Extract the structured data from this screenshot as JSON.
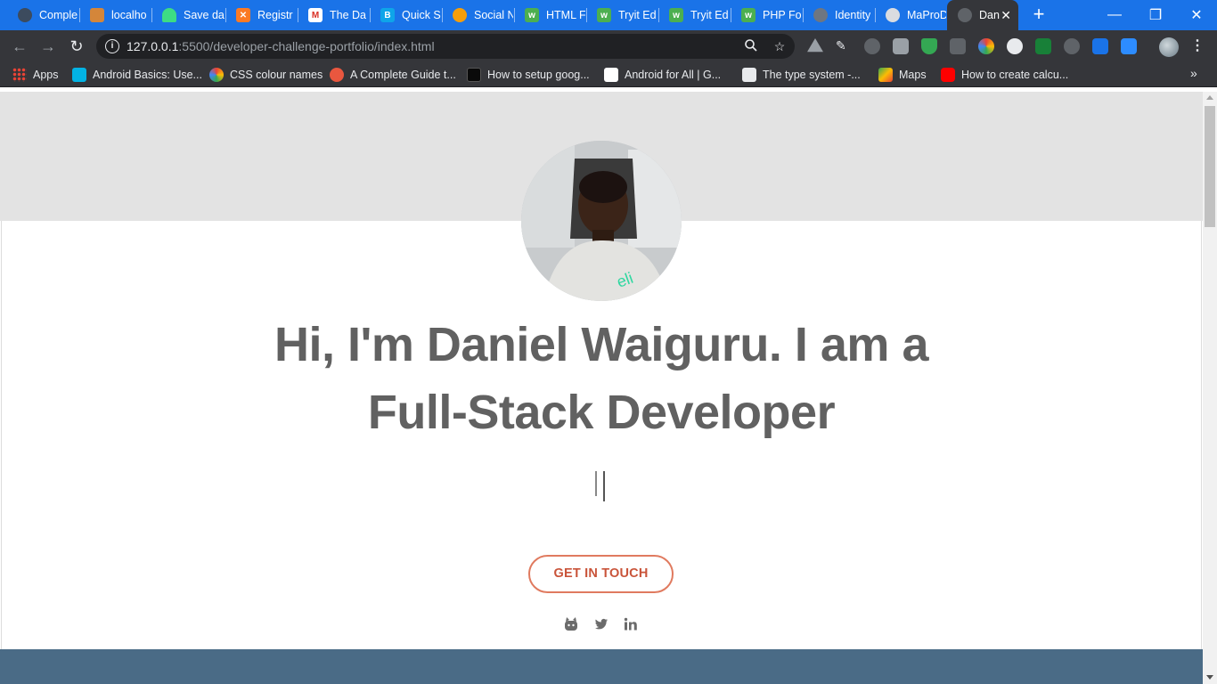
{
  "browser": {
    "tabs": [
      {
        "title": "Comple",
        "icon": "github-icon",
        "color": "#24292e",
        "active": false
      },
      {
        "title": "localho",
        "icon": "server-icon",
        "color": "#f4a460",
        "active": false
      },
      {
        "title": "Save da",
        "icon": "android-icon",
        "color": "#3ddc84",
        "active": false
      },
      {
        "title": "Registr",
        "icon": "xampp-icon",
        "color": "#fb7a24",
        "active": false
      },
      {
        "title": "The Da",
        "icon": "gmail-icon",
        "color": "#d93025",
        "active": false
      },
      {
        "title": "Quick S",
        "icon": "bootstrap-icon",
        "color": "#0ea5e9",
        "active": false
      },
      {
        "title": "Social N",
        "icon": "settings-icon",
        "color": "#f59e0b",
        "active": false
      },
      {
        "title": "HTML F",
        "icon": "w3schools-icon",
        "color": "#4caf50",
        "active": false
      },
      {
        "title": "Tryit Ed",
        "icon": "w3schools-icon",
        "color": "#4caf50",
        "active": false
      },
      {
        "title": "Tryit Ed",
        "icon": "w3schools-icon",
        "color": "#4caf50",
        "active": false
      },
      {
        "title": "PHP For",
        "icon": "w3schools-icon",
        "color": "#4caf50",
        "active": false
      },
      {
        "title": "Identity",
        "icon": "github-icon",
        "color": "#6e7681",
        "active": false
      },
      {
        "title": "MaProD",
        "icon": "globe-icon",
        "color": "#9aa0a6",
        "active": false
      },
      {
        "title": "Dan",
        "icon": "globe-icon",
        "color": "#9aa0a6",
        "active": true
      }
    ],
    "new_tab_label": "+",
    "window_controls": {
      "minimize": "—",
      "restore": "❐",
      "close": "✕"
    },
    "address": {
      "host": "127.0.0.1",
      "path": ":5500/developer-challenge-portfolio/index.html"
    },
    "bookmarks": [
      {
        "label": "Apps",
        "icon": "apps-grid-icon",
        "color": "#ea4335"
      },
      {
        "label": "Android Basics: Use...",
        "icon": "udacity-icon",
        "color": "#02b3e4"
      },
      {
        "label": "CSS colour names",
        "icon": "chrome-colors-icon",
        "color": "#fbbc04"
      },
      {
        "label": "A Complete Guide t...",
        "icon": "css-tricks-icon",
        "color": "#e9573f"
      },
      {
        "label": "How to setup goog...",
        "icon": "dev-icon",
        "color": "#0a0a0a"
      },
      {
        "label": "Android for All  |  G...",
        "icon": "android-dev-icon",
        "color": "#ffffff"
      },
      {
        "label": "The type system -...",
        "icon": "page-icon",
        "color": "#e8eaed"
      },
      {
        "label": "Maps",
        "icon": "maps-icon",
        "color": "#34a853"
      },
      {
        "label": "How to create calcu...",
        "icon": "youtube-icon",
        "color": "#ff0000"
      }
    ],
    "bookmarks_overflow": "»"
  },
  "page": {
    "headline": "Hi, I'm Daniel Waiguru. I am a Full-Stack Developer",
    "cta_label": "GET IN TOUCH",
    "colors": {
      "band": "#e3e3e3",
      "headline": "#616161",
      "accent": "#e07a5f",
      "footer": "#4a6b86"
    },
    "social": [
      {
        "name": "github-icon"
      },
      {
        "name": "twitter-icon"
      },
      {
        "name": "linkedin-icon"
      }
    ]
  }
}
